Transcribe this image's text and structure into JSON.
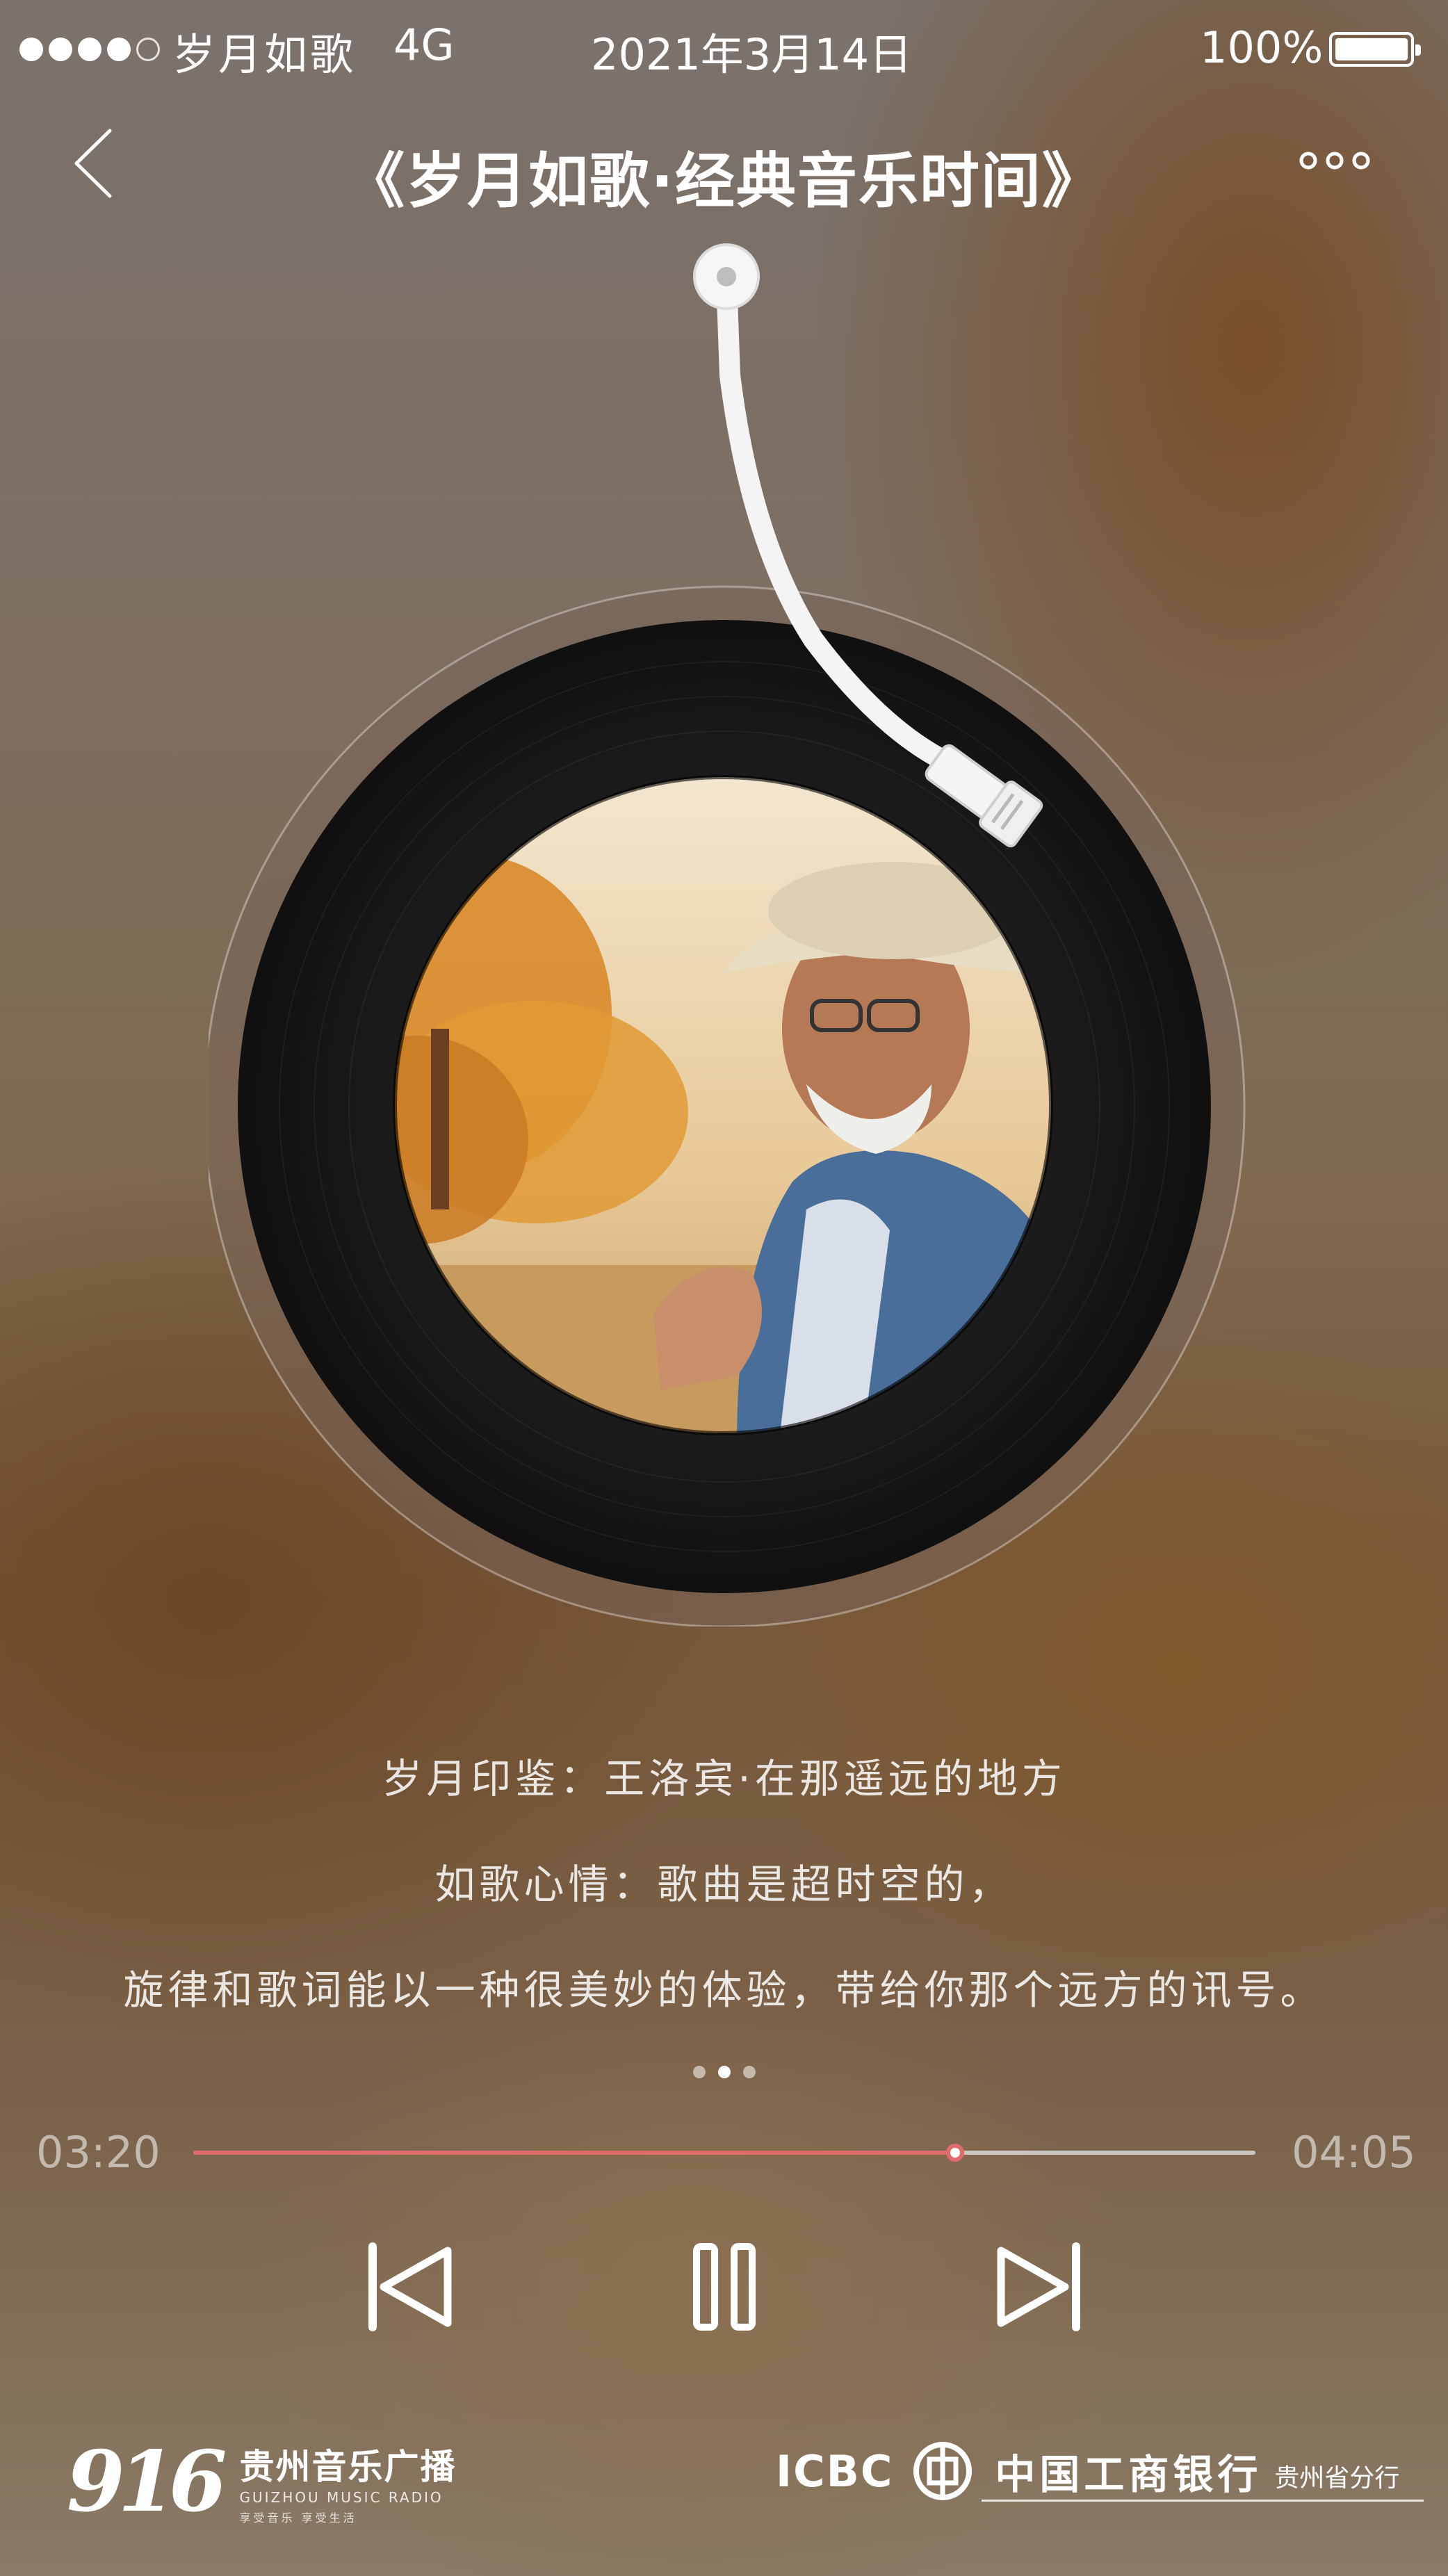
{
  "status_bar": {
    "carrier": "岁月如歌",
    "network": "4G",
    "date": "2021年3月14日",
    "battery": "100%",
    "signal_bars": 4,
    "signal_max": 5,
    "battery_level": 1.0
  },
  "nav": {
    "title": "《岁月如歌·经典音乐时间》",
    "back_icon": "chevron-left-icon",
    "more_icon": "more-dots-icon"
  },
  "album": {
    "cover_icon": "album-cover-portrait-icon"
  },
  "lyrics": {
    "line1": "岁月印鉴：王洛宾·在那遥远的地方",
    "line2": "如歌心情：歌曲是超时空的，",
    "line3": "旋律和歌词能以一种很美妙的体验，带给你那个远方的讯号。"
  },
  "pager": {
    "count": 3,
    "active": 1
  },
  "player": {
    "elapsed": "03:20",
    "duration": "04:05",
    "progress": 0.717,
    "accent_color": "#e06b6b",
    "prev_icon": "skip-previous-icon",
    "pause_icon": "pause-icon",
    "next_icon": "skip-next-icon"
  },
  "footer": {
    "radio_number": "916",
    "radio_name": "贵州音乐广播",
    "radio_en": "GUIZHOU MUSIC RADIO",
    "radio_slogan": "享受音乐 享受生活",
    "bank_en": "ICBC",
    "bank_name": "中国工商银行",
    "bank_branch": "贵州省分行"
  }
}
